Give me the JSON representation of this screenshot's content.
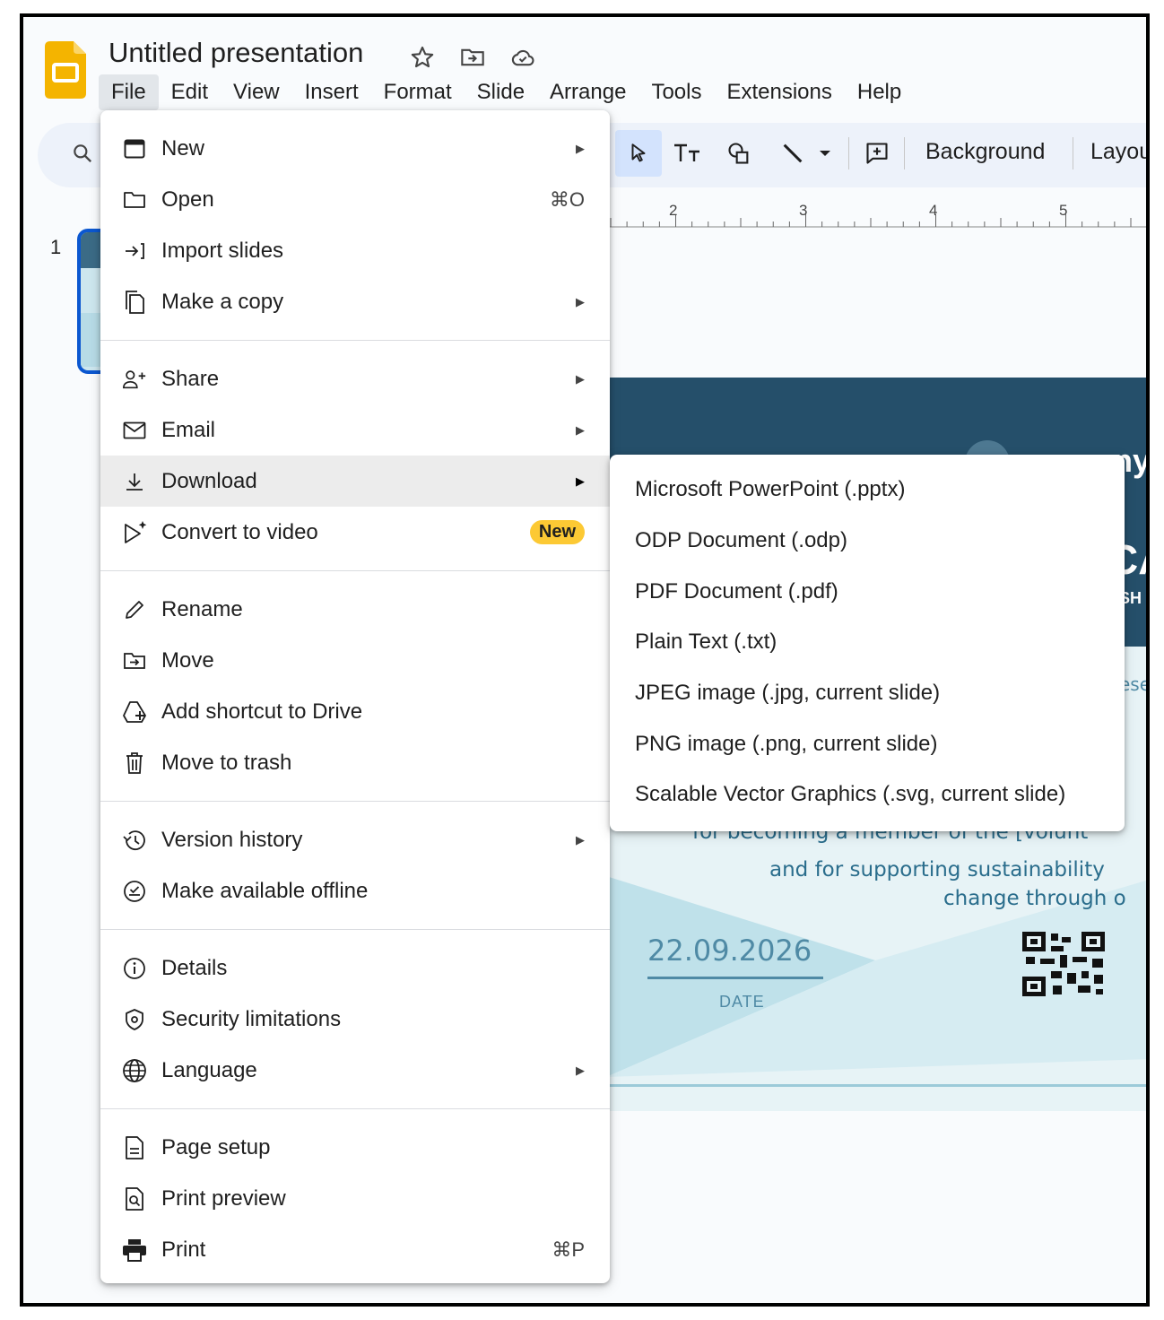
{
  "app": {
    "title": "Untitled presentation",
    "accent_color": "#0b57d0",
    "logo_color": "#f4b400"
  },
  "menubar": {
    "items": [
      "File",
      "Edit",
      "View",
      "Insert",
      "Format",
      "Slide",
      "Arrange",
      "Tools",
      "Extensions",
      "Help"
    ],
    "active": "File"
  },
  "toolbar": {
    "background_label": "Background",
    "layout_label": "Layou"
  },
  "ruler": {
    "labels": [
      "2",
      "3",
      "4",
      "5"
    ]
  },
  "filmstrip": {
    "slide_number": "1"
  },
  "slide": {
    "line1": "for becoming a member of the [volunt",
    "line2": "and for supporting sustainability",
    "line3": "change through o",
    "partial_top": "ny",
    "partial_ca": "CA",
    "partial_sh": "SH",
    "partial_se": "ese",
    "date": "22.09.2026",
    "date_label": "DATE"
  },
  "file_menu": {
    "items": [
      {
        "label": "New",
        "icon": "slides-new-icon",
        "submenu": true
      },
      {
        "label": "Open",
        "icon": "folder-open-icon",
        "shortcut": "⌘O"
      },
      {
        "label": "Import slides",
        "icon": "import-icon"
      },
      {
        "label": "Make a copy",
        "icon": "copy-icon",
        "submenu": true
      },
      {
        "label": "Share",
        "icon": "person-add-icon",
        "submenu": true
      },
      {
        "label": "Email",
        "icon": "email-icon",
        "submenu": true
      },
      {
        "label": "Download",
        "icon": "download-icon",
        "submenu": true,
        "highlighted": true
      },
      {
        "label": "Convert to video",
        "icon": "video-sparkle-icon",
        "badge": "New"
      },
      {
        "label": "Rename",
        "icon": "pencil-icon"
      },
      {
        "label": "Move",
        "icon": "folder-move-icon"
      },
      {
        "label": "Add shortcut to Drive",
        "icon": "drive-shortcut-icon"
      },
      {
        "label": "Move to trash",
        "icon": "trash-icon"
      },
      {
        "label": "Version history",
        "icon": "history-icon",
        "submenu": true
      },
      {
        "label": "Make available offline",
        "icon": "offline-icon"
      },
      {
        "label": "Details",
        "icon": "info-icon"
      },
      {
        "label": "Security limitations",
        "icon": "shield-icon"
      },
      {
        "label": "Language",
        "icon": "globe-icon",
        "submenu": true
      },
      {
        "label": "Page setup",
        "icon": "page-icon"
      },
      {
        "label": "Print preview",
        "icon": "print-preview-icon"
      },
      {
        "label": "Print",
        "icon": "printer-icon",
        "shortcut": "⌘P"
      }
    ]
  },
  "download_submenu": {
    "items": [
      "Microsoft PowerPoint (.pptx)",
      "ODP Document (.odp)",
      "PDF Document (.pdf)",
      "Plain Text (.txt)",
      "JPEG image (.jpg, current slide)",
      "PNG image (.png, current slide)",
      "Scalable Vector Graphics (.svg, current slide)"
    ]
  }
}
